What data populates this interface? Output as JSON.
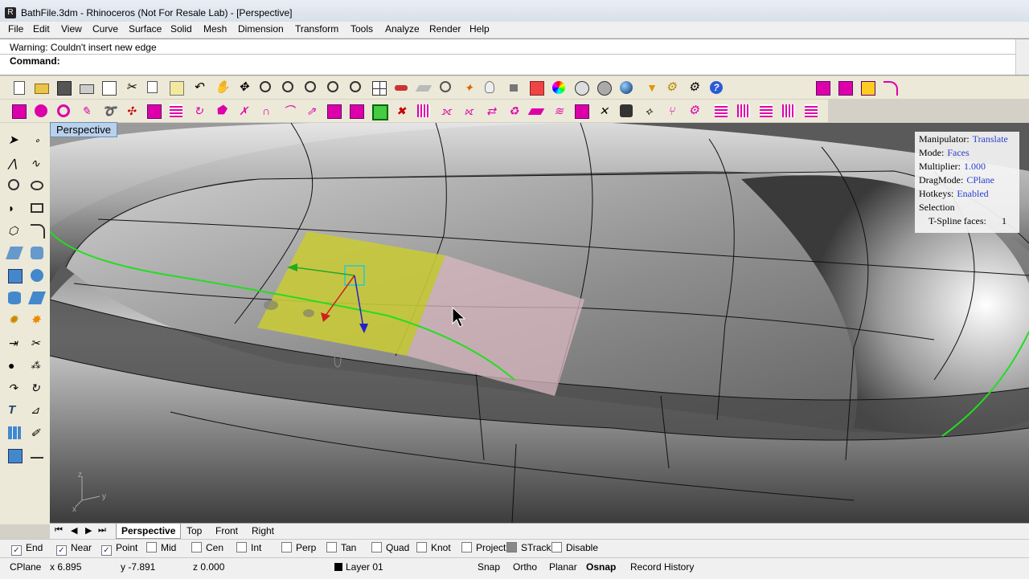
{
  "window": {
    "title": "BathFile.3dm - Rhinoceros (Not For Resale Lab) - [Perspective]"
  },
  "menu": [
    "File",
    "Edit",
    "View",
    "Curve",
    "Surface",
    "Solid",
    "Mesh",
    "Dimension",
    "Transform",
    "Tools",
    "Analyze",
    "Render",
    "Help"
  ],
  "command": {
    "history": "Warning: Couldn't insert new edge",
    "prompt": "Command:"
  },
  "viewport": {
    "title": "Perspective",
    "axis": {
      "x": "x",
      "y": "y",
      "z": "z"
    },
    "manipulator_panel": {
      "rows": [
        {
          "label": "Manipulator:",
          "value": "Translate"
        },
        {
          "label": "Mode:",
          "value": "Faces"
        },
        {
          "label": "Multiplier:",
          "value": "1.000"
        },
        {
          "label": "DragMode:",
          "value": "CPlane"
        },
        {
          "label": "Hotkeys:",
          "value": "Enabled"
        },
        {
          "label": "Selection",
          "value": ""
        },
        {
          "label": "T-Spline faces:",
          "value": "1"
        }
      ]
    }
  },
  "view_tabs": [
    "Perspective",
    "Top",
    "Front",
    "Right"
  ],
  "active_tab": "Perspective",
  "osnaps": [
    {
      "label": "End",
      "checked": true
    },
    {
      "label": "Near",
      "checked": true
    },
    {
      "label": "Point",
      "checked": true
    },
    {
      "label": "Mid",
      "checked": false
    },
    {
      "label": "Cen",
      "checked": false
    },
    {
      "label": "Int",
      "checked": false
    },
    {
      "label": "Perp",
      "checked": false
    },
    {
      "label": "Tan",
      "checked": false
    },
    {
      "label": "Quad",
      "checked": false
    },
    {
      "label": "Knot",
      "checked": false
    },
    {
      "label": "Project",
      "checked": false
    },
    {
      "label": "STrack",
      "checked": false,
      "gray": true
    },
    {
      "label": "Disable",
      "checked": false
    }
  ],
  "status": {
    "cplane": "CPlane",
    "x": "x 6.895",
    "y": "y -7.891",
    "z": "z 0.000",
    "layer": "Layer 01",
    "snap": "Snap",
    "ortho": "Ortho",
    "planar": "Planar",
    "osnap": "Osnap",
    "record": "Record History"
  },
  "colors": {
    "selected_face": "#c9c93a",
    "pink_face": "#d9b8c0",
    "curve": "#22dd22",
    "label_value": "#2a3fd0"
  }
}
